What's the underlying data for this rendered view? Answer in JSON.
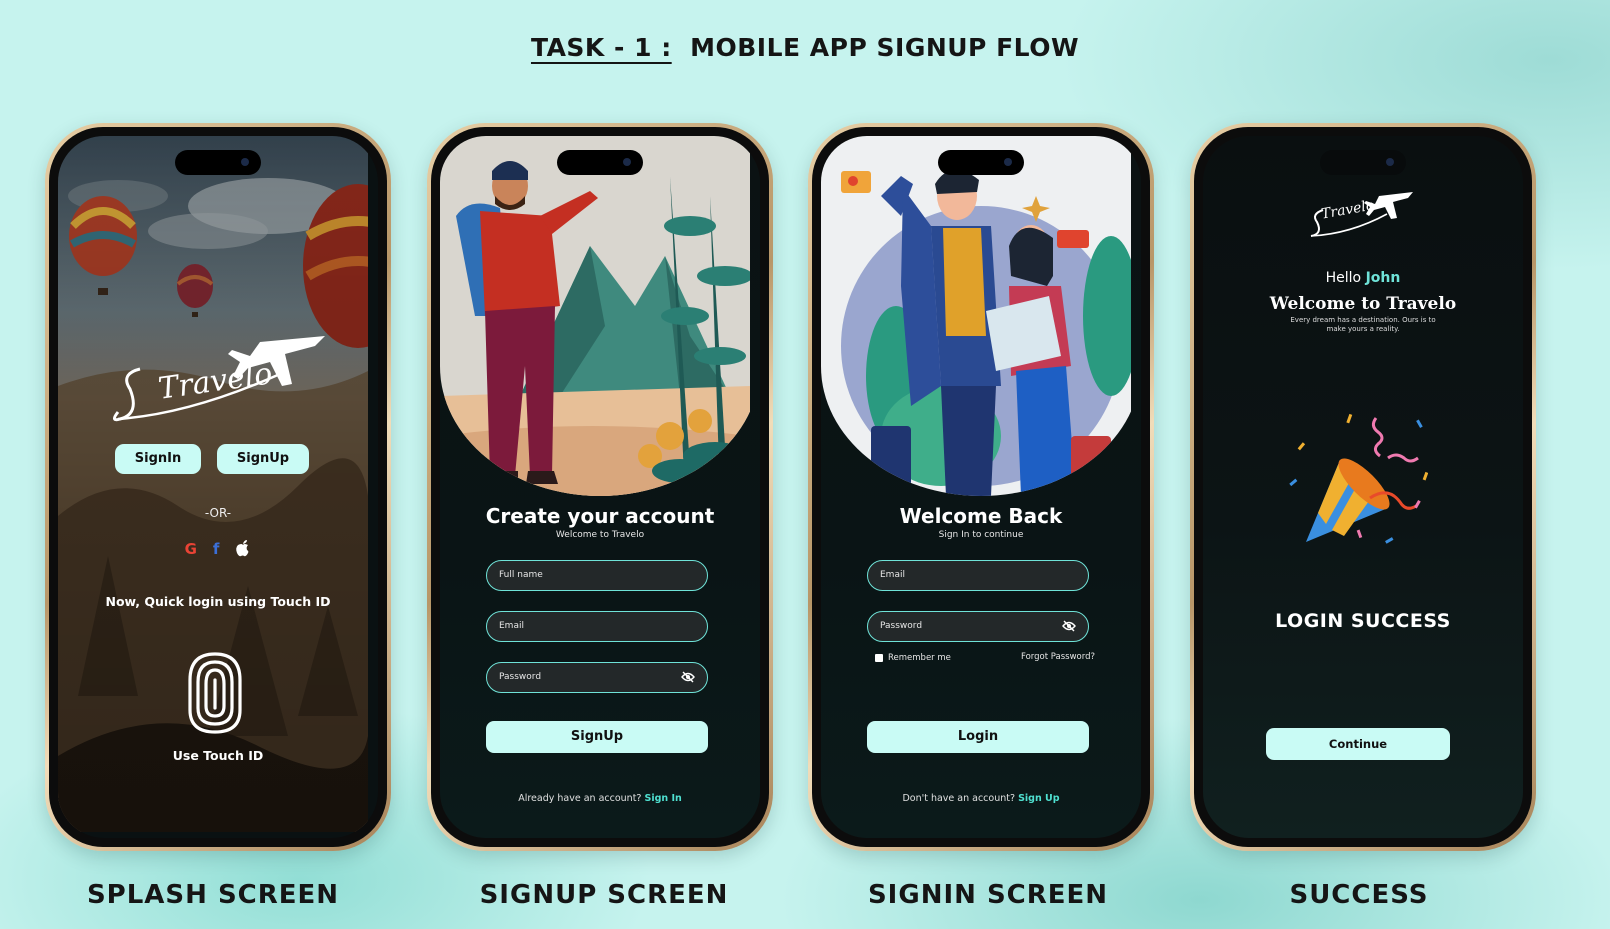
{
  "header": {
    "task": "TASK - 1 :",
    "title": "MOBILE APP SIGNUP FLOW"
  },
  "captions": [
    "SPLASH SCREEN",
    "SIGNUP SCREEN",
    "SIGNIN SCREEN",
    "SUCCESS"
  ],
  "splash": {
    "logo_text": "Travelo",
    "signin_label": "SignIn",
    "signup_label": "SignUp",
    "or_text": "-OR-",
    "quick_login": "Now, Quick login using Touch ID",
    "touch_id_label": "Use Touch ID",
    "social_icons": [
      "google-icon",
      "facebook-icon",
      "apple-icon"
    ]
  },
  "signup": {
    "heading": "Create your account",
    "subheading": "Welcome to Travelo",
    "fullname_placeholder": "Full name",
    "email_placeholder": "Email",
    "password_placeholder": "Password",
    "button_label": "SignUp",
    "footer_text": "Already have an account?",
    "footer_link": "Sign In"
  },
  "signin": {
    "heading": "Welcome Back",
    "subheading": "Sign In to continue",
    "email_placeholder": "Email",
    "password_placeholder": "Password",
    "remember_label": "Remember me",
    "forgot_label": "Forgot Password?",
    "button_label": "Login",
    "footer_text": "Don't have an account?",
    "footer_link": "Sign Up"
  },
  "success": {
    "logo_text": "Travelo",
    "hello": "Hello",
    "name": "John",
    "welcome": "Welcome to Travelo",
    "tagline_1": "Every dream has a destination. Ours is to",
    "tagline_2": "make yours a reality.",
    "status": "LOGIN SUCCESS",
    "button_label": "Continue"
  },
  "colors": {
    "accent": "#c9fbf5",
    "link": "#4fe0d0",
    "background": "#c6f3ee",
    "screen": "#0a1112"
  }
}
